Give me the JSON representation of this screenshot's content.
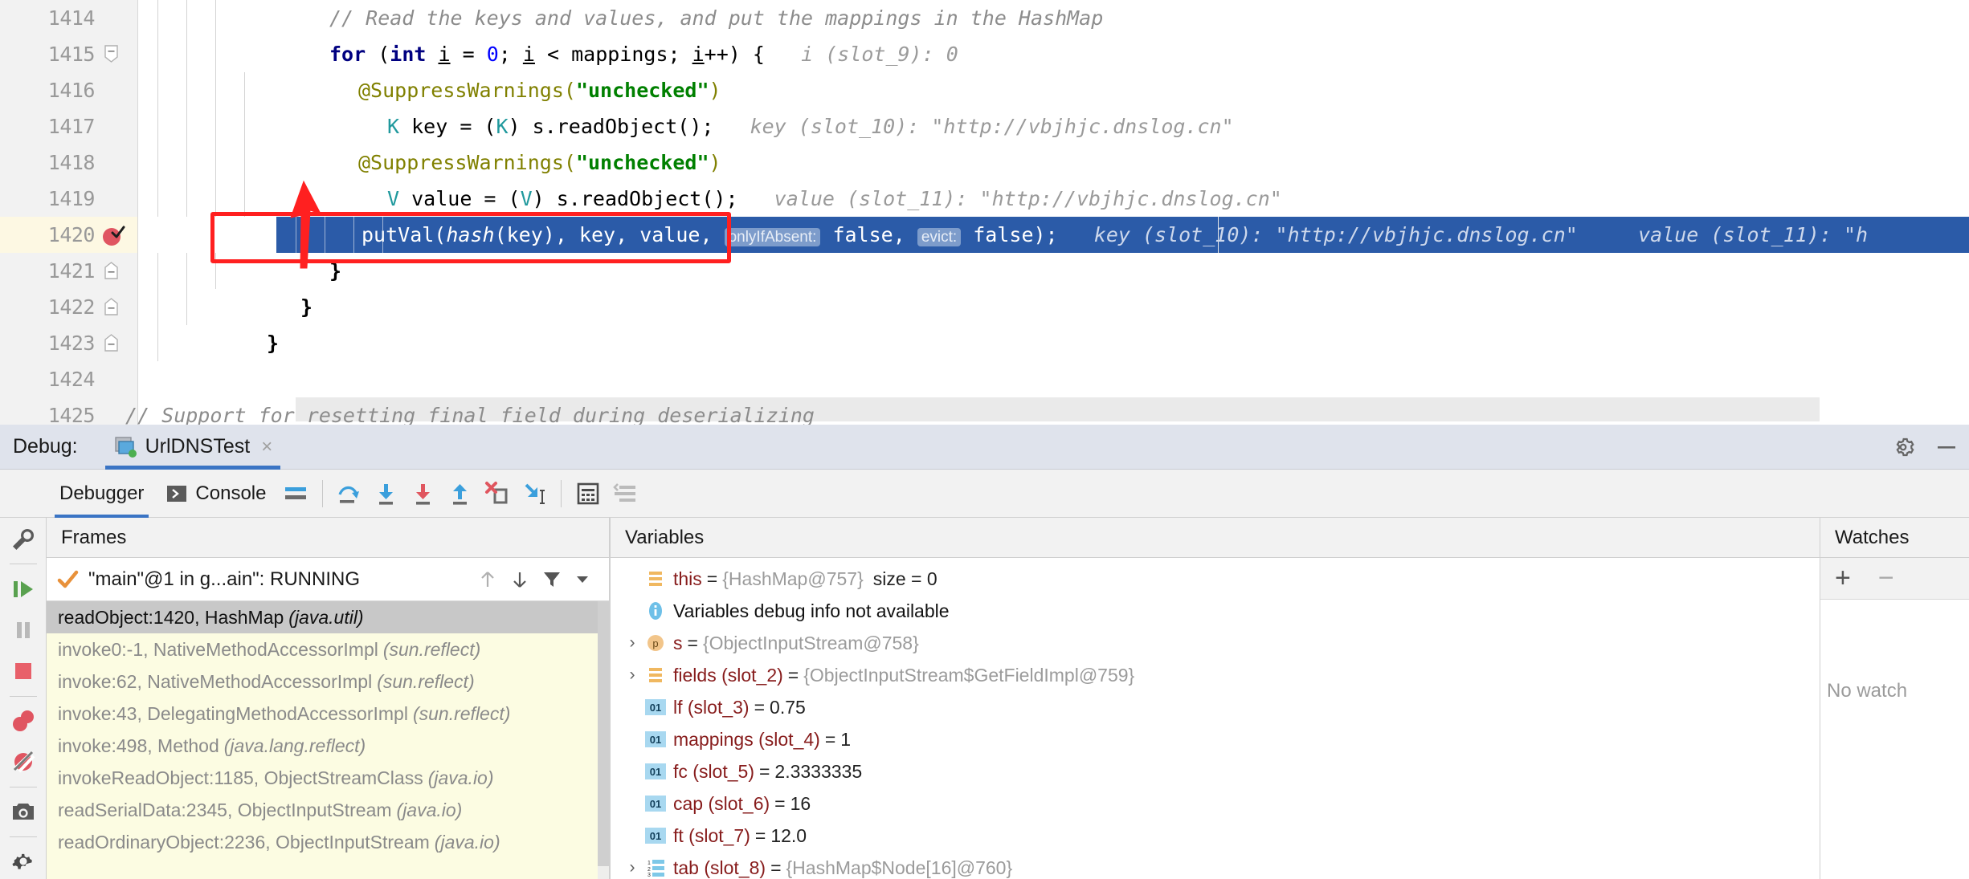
{
  "editor": {
    "lines": [
      {
        "no": "1414",
        "indent": 238,
        "fold": false,
        "bp": false
      },
      {
        "no": "1415",
        "indent": 238,
        "fold": true,
        "bp": false
      },
      {
        "no": "1416",
        "indent": 274,
        "fold": false,
        "bp": false
      },
      {
        "no": "1417",
        "indent": 310,
        "fold": false,
        "bp": false
      },
      {
        "no": "1418",
        "indent": 274,
        "fold": false,
        "bp": false
      },
      {
        "no": "1419",
        "indent": 310,
        "fold": false,
        "bp": false
      },
      {
        "no": "1420",
        "indent": 278,
        "fold": false,
        "bp": true
      },
      {
        "no": "1421",
        "indent": 238,
        "fold": true,
        "bp": false
      },
      {
        "no": "1422",
        "indent": 202,
        "fold": true,
        "bp": false
      },
      {
        "no": "1423",
        "indent": 160,
        "fold": true,
        "bp": false
      },
      {
        "no": "1424",
        "indent": 160,
        "fold": false,
        "bp": false
      },
      {
        "no": "1425",
        "indent": 160,
        "fold": false,
        "bp": false
      }
    ],
    "line_1414_comment": "// Read the keys and values, and put the mappings in the HashMap",
    "line_1415": {
      "kw_for": "for",
      "open_paren": " (",
      "kw_int": "int",
      "var_i": "i",
      "assign": " = ",
      "zero": "0",
      "semi": "; ",
      "var_i2": "i",
      "cond": " < mappings; ",
      "var_i3": "i",
      "inc": "++) {",
      "hint": "i (slot_9): 0"
    },
    "line_1416_annotation": "@SuppressWarnings(",
    "line_1416_string": "\"unchecked\"",
    "line_1416_close": ")",
    "line_1417": {
      "type_k": "K",
      "text1": " key = (",
      "type_k2": "K",
      "text2": ") s.readObject();",
      "hint": "key (slot_10): \"http://vbjhjc.dnslog.cn\""
    },
    "line_1418_annotation": "@SuppressWarnings(",
    "line_1418_string": "\"unchecked\"",
    "line_1418_close": ")",
    "line_1419": {
      "type_v": "V",
      "text1": " value = (",
      "type_v2": "V",
      "text2": ") s.readObject();",
      "hint": "value (slot_11): \"http://vbjhjc.dnslog.cn\""
    },
    "line_1420": {
      "call": "putVal(",
      "hash_fn": "hash",
      "args1": "(key), key, value, ",
      "chip_only": "onlyIfAbsent:",
      "false1": " false, ",
      "chip_evict": "evict:",
      "false2": " false);",
      "hint_key": "key (slot_10): \"http://vbjhjc.dnslog.cn\"",
      "hint_value": "value (slot_11): \"h"
    },
    "line_1421_brace": "}",
    "line_1422_brace": "}",
    "line_1423_brace": "}",
    "line_1425_comment": "// Support for resetting final field during deserializing"
  },
  "debug": {
    "label": "Debug:",
    "tab_name": "UrlDNSTest",
    "tab_close": "×",
    "settings_icon": "gear-icon",
    "minimize_icon": "minimize-icon",
    "toolbar": {
      "rerun_icon": "rerun-icon",
      "tabs": [
        {
          "label": "Debugger",
          "active": true
        },
        {
          "label": "Console",
          "active": false
        }
      ],
      "icons": [
        "mute-breakpoints-icon",
        "step-over-icon",
        "step-into-icon",
        "force-step-into-icon",
        "step-out-icon",
        "drop-frame-icon",
        "run-to-cursor-icon",
        "evaluate-expression-icon",
        "layout-settings-icon"
      ]
    },
    "rail_icons": [
      "rerun-debug-icon",
      "settings-wrench-icon",
      "resume-program-icon",
      "pause-program-icon",
      "stop-program-icon",
      "view-breakpoints-icon",
      "mute-breakpoints-icon",
      "screenshot-icon",
      "settings-gear-icon"
    ]
  },
  "frames": {
    "header": "Frames",
    "thread": "\"main\"@1 in g...ain\": RUNNING",
    "thread_check_icon": "check-icon",
    "tools": [
      "arrow-up-icon",
      "arrow-down-icon",
      "filter-icon",
      "chevron-down-icon"
    ],
    "items": [
      {
        "text": "readObject:1420, HashMap",
        "pkg": "(java.util)",
        "selected": true
      },
      {
        "text": "invoke0:-1, NativeMethodAccessorImpl",
        "pkg": "(sun.reflect)",
        "selected": false
      },
      {
        "text": "invoke:62, NativeMethodAccessorImpl",
        "pkg": "(sun.reflect)",
        "selected": false
      },
      {
        "text": "invoke:43, DelegatingMethodAccessorImpl",
        "pkg": "(sun.reflect)",
        "selected": false
      },
      {
        "text": "invoke:498, Method",
        "pkg": "(java.lang.reflect)",
        "selected": false
      },
      {
        "text": "invokeReadObject:1185, ObjectStreamClass",
        "pkg": "(java.io)",
        "selected": false
      },
      {
        "text": "readSerialData:2345, ObjectInputStream",
        "pkg": "(java.io)",
        "selected": false
      },
      {
        "text": "readOrdinaryObject:2236, ObjectInputStream",
        "pkg": "(java.io)",
        "selected": false
      }
    ]
  },
  "variables": {
    "header": "Variables",
    "items": [
      {
        "chev": "",
        "icon": "field-icon",
        "name": "this",
        "eq": "=",
        "value": "{HashMap@757}",
        "extra": "size = 0",
        "kind": "field"
      },
      {
        "chev": "",
        "icon": "info-icon",
        "name": "",
        "eq": "",
        "value": "",
        "extra": "",
        "kind": "info",
        "info_text": "Variables debug info not available"
      },
      {
        "chev": "›",
        "icon": "param-icon",
        "name": "s",
        "eq": "=",
        "value": "{ObjectInputStream@758}",
        "extra": "",
        "kind": "param"
      },
      {
        "chev": "›",
        "icon": "field-icon",
        "name": "fields (slot_2)",
        "eq": "=",
        "value": "{ObjectInputStream$GetFieldImpl@759}",
        "extra": "",
        "kind": "field"
      },
      {
        "chev": "",
        "icon": "primitive-icon",
        "name": "lf (slot_3)",
        "eq": "=",
        "value": "0.75",
        "extra": "",
        "kind": "primitive"
      },
      {
        "chev": "",
        "icon": "primitive-icon",
        "name": "mappings (slot_4)",
        "eq": "=",
        "value": "1",
        "extra": "",
        "kind": "primitive"
      },
      {
        "chev": "",
        "icon": "primitive-icon",
        "name": "fc (slot_5)",
        "eq": "=",
        "value": "2.3333335",
        "extra": "",
        "kind": "primitive"
      },
      {
        "chev": "",
        "icon": "primitive-icon",
        "name": "cap (slot_6)",
        "eq": "=",
        "value": "16",
        "extra": "",
        "kind": "primitive"
      },
      {
        "chev": "",
        "icon": "primitive-icon",
        "name": "ft (slot_7)",
        "eq": "=",
        "value": "12.0",
        "extra": "",
        "kind": "primitive"
      },
      {
        "chev": "›",
        "icon": "array-icon",
        "name": "tab (slot_8)",
        "eq": "=",
        "value": "{HashMap$Node[16]@760}",
        "extra": "",
        "kind": "array"
      }
    ]
  },
  "watches": {
    "header": "Watches",
    "add_label": "+",
    "remove_label": "−",
    "empty_text": "No watch"
  },
  "colors": {
    "selection_blue": "#2b5ba8",
    "current_line_yellow": "#fdf8e3",
    "annotation_red": "#ff2020",
    "frames_bg": "#fcfce2",
    "accent": "#3a74c4"
  }
}
